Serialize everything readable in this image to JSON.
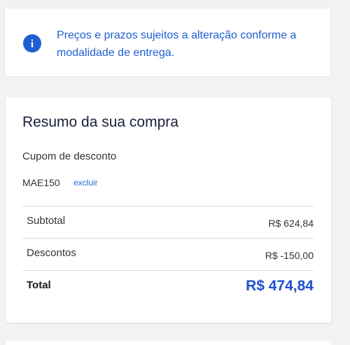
{
  "notice": {
    "text": "Preços e prazos sujeitos a alteração conforme a modalidade de entrega.",
    "icon": "info-icon"
  },
  "summary": {
    "title": "Resumo da sua compra",
    "coupon_label": "Cupom de desconto",
    "coupon_code": "MAE150",
    "remove_label": "excluir",
    "rows": [
      {
        "label": "Subtotal",
        "value": "R$ 624,84"
      },
      {
        "label": "Descontos",
        "value": "R$ -150,00"
      },
      {
        "label": "Total",
        "value": "R$ 474,84"
      }
    ]
  },
  "colors": {
    "accent": "#1f5fd1",
    "total": "#1f4fd1",
    "link": "#1f6ad9",
    "title": "#1a1f3b"
  }
}
